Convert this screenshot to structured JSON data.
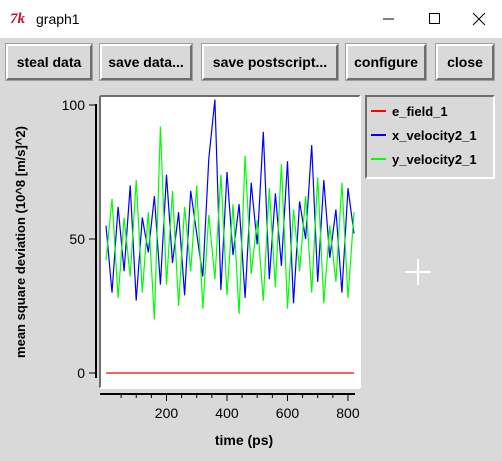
{
  "window": {
    "app_icon": "7k",
    "title": "graph1",
    "minimize_icon": "minimize-icon",
    "maximize_icon": "maximize-icon",
    "close_icon": "close-icon"
  },
  "toolbar": {
    "steal_label": "steal data",
    "save_label": "save data...",
    "postscript_label": "save postscript...",
    "configure_label": "configure",
    "close_label": "close"
  },
  "colors": {
    "e_field": "#ff0000",
    "x_velocity": "#0000ff",
    "y_velocity": "#00ff00",
    "plot_background": "#ffffff",
    "window_background": "#d9d9d9"
  },
  "chart_data": {
    "type": "line",
    "title": "",
    "xlabel": "time (ps)",
    "ylabel": "mean square deviation (10^8 [m/s]^2)",
    "xlim": [
      0,
      820
    ],
    "ylim": [
      0,
      100
    ],
    "xticks": [
      200,
      400,
      600,
      800
    ],
    "yticks": [
      0,
      50,
      100
    ],
    "grid": false,
    "legend_position": "right",
    "series": [
      {
        "name": "e_field_1",
        "color": "#ff0000",
        "x": [
          0,
          820
        ],
        "y": [
          0,
          0
        ]
      },
      {
        "name": "x_velocity2_1",
        "color": "#0000ff",
        "x": [
          0,
          20,
          40,
          60,
          80,
          100,
          120,
          140,
          160,
          180,
          200,
          220,
          240,
          260,
          280,
          300,
          320,
          340,
          360,
          380,
          400,
          420,
          440,
          460,
          480,
          500,
          520,
          540,
          560,
          580,
          600,
          620,
          640,
          660,
          680,
          700,
          720,
          740,
          760,
          780,
          800,
          820
        ],
        "y": [
          55,
          30,
          62,
          38,
          70,
          27,
          58,
          45,
          66,
          33,
          74,
          41,
          60,
          29,
          68,
          52,
          36,
          80,
          102,
          31,
          75,
          44,
          63,
          28,
          71,
          48,
          90,
          35,
          67,
          40,
          79,
          26,
          64,
          50,
          85,
          34,
          72,
          43,
          61,
          30,
          69,
          52
        ]
      },
      {
        "name": "y_velocity2_1",
        "color": "#00ff00",
        "x": [
          0,
          20,
          40,
          60,
          80,
          100,
          120,
          140,
          160,
          180,
          200,
          220,
          240,
          260,
          280,
          300,
          320,
          340,
          360,
          380,
          400,
          420,
          440,
          460,
          480,
          500,
          520,
          540,
          560,
          580,
          600,
          620,
          640,
          660,
          680,
          700,
          720,
          740,
          760,
          780,
          800,
          820
        ],
        "y": [
          42,
          65,
          28,
          58,
          36,
          72,
          30,
          60,
          20,
          92,
          33,
          68,
          25,
          62,
          38,
          70,
          24,
          59,
          35,
          74,
          29,
          63,
          22,
          81,
          37,
          57,
          27,
          69,
          32,
          78,
          24,
          61,
          38,
          66,
          30,
          73,
          26,
          55,
          34,
          71,
          28,
          60
        ]
      }
    ]
  }
}
